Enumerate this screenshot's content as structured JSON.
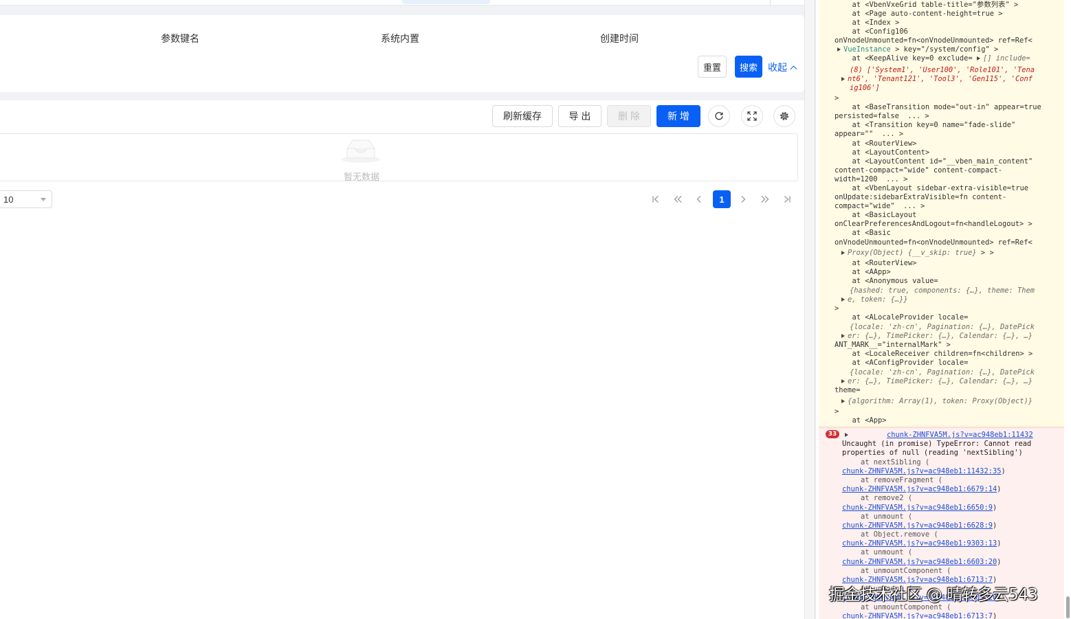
{
  "search_form": {
    "fields": [
      "参数键名",
      "系统内置",
      "创建时间"
    ],
    "reset_label": "重置",
    "search_label": "搜索",
    "collapse_label": "收起"
  },
  "toolbar": {
    "refresh_cache_label": "刷新缓存",
    "export_label": "导 出",
    "delete_label": "删 除",
    "add_label": "新 增"
  },
  "table": {
    "empty_text": "暂无数据"
  },
  "pagination": {
    "page_size": "10",
    "current_page": "1"
  },
  "console": {
    "warn_lines": [
      {
        "pre": "  at <VbenVxeGrid table-title=\"参数列表\" >"
      },
      {
        "pre": "  at <Page auto-content-height=true >"
      },
      {
        "pre": "  at <Index >"
      },
      {
        "pre": "  at <Config106"
      },
      {
        "pre": "onVnodeUnmounted=fn<onVnodeUnmounted> ref=Ref<"
      },
      {
        "pre": "VueInstance",
        "post": " > key=\"/system/config\" >"
      },
      {
        "pre": "  at <KeepAlive key=0 exclude= ",
        "post": "[] include="
      },
      {
        "pre": "(8) ['System1', 'User100', 'Role101', 'Tena"
      },
      {
        "pre": "nt6', 'Tenant121', 'Tool3', 'Gen115', 'Conf"
      },
      {
        "pre": "ig106']"
      },
      {
        "pre": ">"
      },
      {
        "pre": "  at <BaseTransition mode=\"out-in\" appear=true"
      },
      {
        "pre": "persisted=false  ... >"
      },
      {
        "pre": "  at <Transition key=0 name=\"fade-slide\""
      },
      {
        "pre": "appear=\"\"  ... >"
      },
      {
        "pre": "  at <RouterView>"
      },
      {
        "pre": "  at <LayoutContent>"
      },
      {
        "pre": "  at <LayoutContent id=\"__vben_main_content\""
      },
      {
        "pre": "content-compact=\"wide\" content-compact-"
      },
      {
        "pre": "width=1200  ... >"
      },
      {
        "pre": "  at <VbenLayout sidebar-extra-visible=true"
      },
      {
        "pre": "onUpdate:sidebarExtraVisible=fn content-"
      },
      {
        "pre": "compact=\"wide\"  ... >"
      },
      {
        "pre": "  at <BasicLayout"
      },
      {
        "pre": "onClearPreferencesAndLogout=fn<handleLogout> >"
      },
      {
        "pre": "  at <Basic"
      },
      {
        "pre": "onVnodeUnmounted=fn<onVnodeUnmounted> ref=Ref<"
      },
      {
        "pre": "Proxy(Object) {__v_skip: true}",
        "post": " > >"
      },
      {
        "pre": "  at <RouterView>"
      },
      {
        "pre": "  at <AApp>"
      },
      {
        "pre": "  at <Anonymous value="
      },
      {
        "pre": "{hashed: true, components: {…}, theme: Them"
      },
      {
        "pre": "e, token: {…}}"
      },
      {
        "pre": ">"
      },
      {
        "pre": "  at <ALocaleProvider locale="
      },
      {
        "pre": "{locale: 'zh-cn', Pagination: {…}, DatePick"
      },
      {
        "pre": "er: {…}, TimePicker: {…}, Calendar: {…}, …}"
      },
      {
        "pre": "ANT_MARK__=\"internalMark\" >"
      },
      {
        "pre": "  at <LocaleReceiver children=fn<children> >"
      },
      {
        "pre": "  at <AConfigProvider locale="
      },
      {
        "pre": "{locale: 'zh-cn', Pagination: {…}, DatePick"
      },
      {
        "pre": "er: {…}, TimePicker: {…}, Calendar: {…}, …}"
      },
      {
        "pre": "theme="
      },
      {
        "pre": "{algorithm: Array(1), token: Proxy(Object)}"
      },
      {
        "pre": ">"
      },
      {
        "pre": "  at <App>"
      }
    ],
    "error_count": "33",
    "error_source": "chunk-ZHNFVA5M.js?v=ac948eb1:11432",
    "error_message": [
      "Uncaught (in promise) TypeError: Cannot read",
      "properties of null (reading 'nextSibling')"
    ],
    "stack": [
      {
        "fn": "at nextSibling (",
        "loc": "chunk-ZHNFVA5M.js?v=ac948eb1:11432:35"
      },
      {
        "fn": "at removeFragment (",
        "loc": "chunk-ZHNFVA5M.js?v=ac948eb1:6679:14"
      },
      {
        "fn": "at remove2 (",
        "loc": "chunk-ZHNFVA5M.js?v=ac948eb1:6650:9"
      },
      {
        "fn": "at unmount (",
        "loc": "chunk-ZHNFVA5M.js?v=ac948eb1:6628:9"
      },
      {
        "fn": "at Object.remove (",
        "loc": "chunk-ZHNFVA5M.js?v=ac948eb1:9303:13"
      },
      {
        "fn": "at unmount (",
        "loc": "chunk-ZHNFVA5M.js?v=ac948eb1:6603:20"
      },
      {
        "fn": "at unmountComponent (",
        "loc": "chunk-ZHNFVA5M.js?v=ac948eb1:6713:7"
      },
      {
        "fn": "at unmount (",
        "loc": "chunk-ZHNFVA5M.js?v=ac948eb1:6603:20"
      },
      {
        "fn": "at unmountComponent (",
        "loc": "chunk-ZHNFVA5M.js?v=ac948eb1:6713:7"
      }
    ]
  },
  "watermark": "掘金技术社区 @ 晴转多云543",
  "colors": {
    "primary": "#0960f4",
    "warn_bg": "#fffbe5",
    "error_bg": "#fff0f0",
    "link": "#1a4ed8"
  },
  "icons": [
    "refresh-icon",
    "fullscreen-icon",
    "settings-gear-icon",
    "first-page-icon",
    "prev-group-icon",
    "prev-page-icon",
    "next-page-icon",
    "next-group-icon",
    "last-page-icon",
    "collapse-chevron-icon",
    "expand-triangle-icon"
  ]
}
